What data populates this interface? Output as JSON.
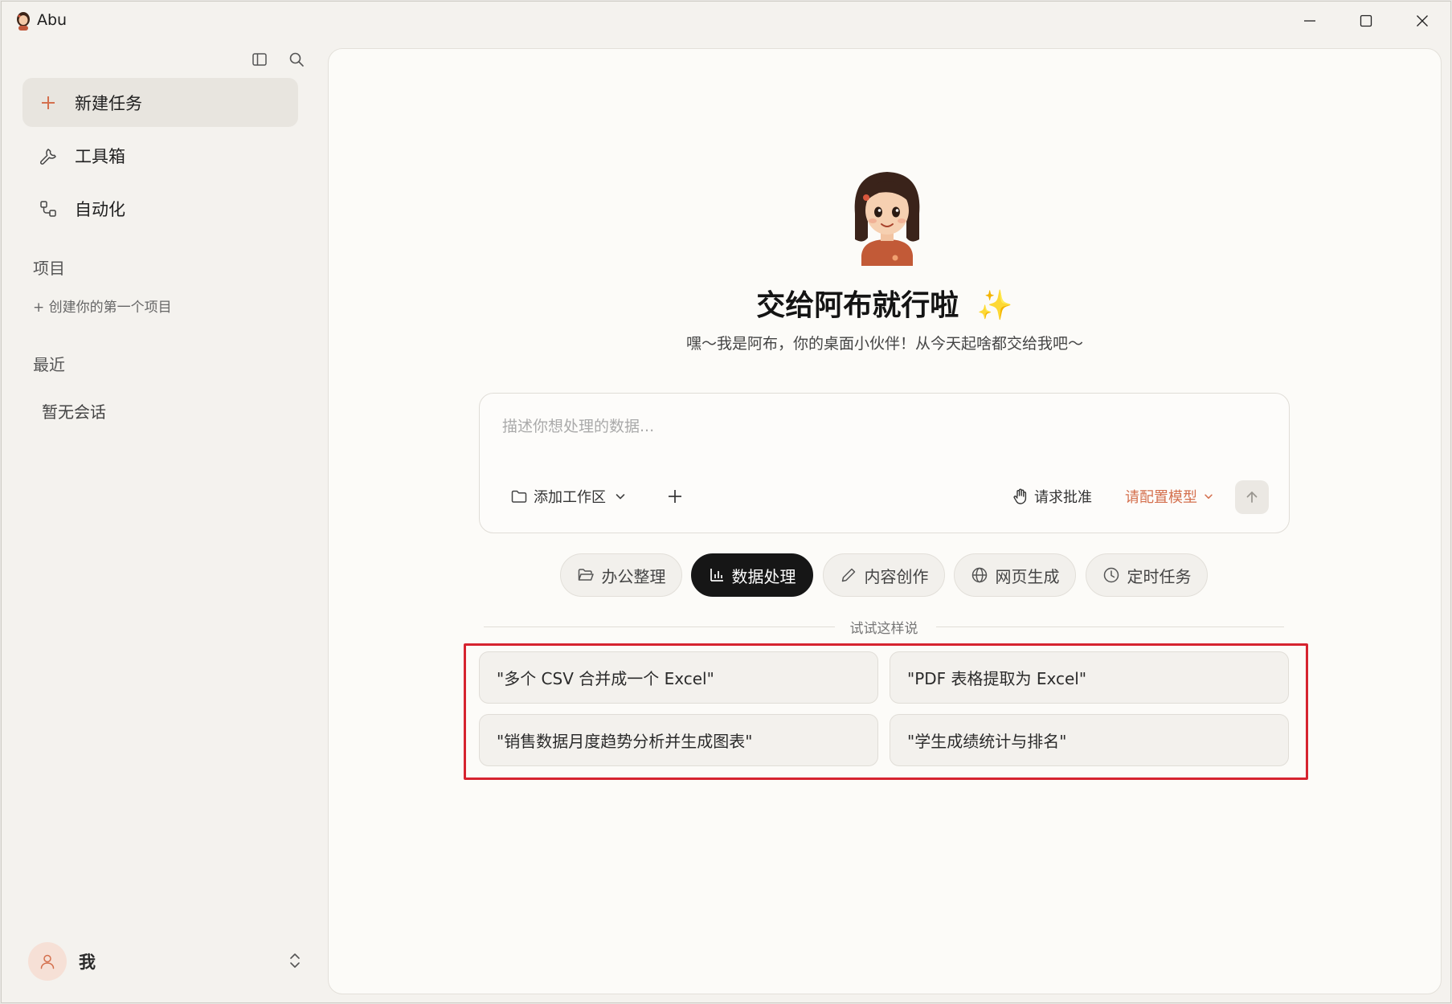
{
  "window": {
    "title": "Abu",
    "controls": [
      "minimize",
      "maximize",
      "close"
    ]
  },
  "sidebar": {
    "toggle_icon": "sidebar-panel-icon",
    "search_icon": "search-icon",
    "nav": [
      {
        "label": "新建任务",
        "icon": "plus-icon",
        "active": true
      },
      {
        "label": "工具箱",
        "icon": "wrench-icon",
        "active": false
      },
      {
        "label": "自动化",
        "icon": "workflow-icon",
        "active": false
      }
    ],
    "projects": {
      "title": "项目",
      "create_label": "+ 创建你的第一个项目"
    },
    "recent": {
      "title": "最近",
      "empty_label": "暂无会话"
    },
    "user": {
      "name": "我"
    }
  },
  "main": {
    "hero_title": "交给阿布就行啦",
    "hero_emoji": "✨",
    "hero_subtitle": "嘿～我是阿布，你的桌面小伙伴！从今天起啥都交给我吧～",
    "input": {
      "placeholder": "描述你想处理的数据...",
      "value": "",
      "workspace_label": "添加工作区",
      "approval_label": "请求批准",
      "model_label": "请配置模型"
    },
    "categories": [
      {
        "label": "办公整理",
        "icon": "folder-open-icon",
        "active": false
      },
      {
        "label": "数据处理",
        "icon": "bar-chart-icon",
        "active": true
      },
      {
        "label": "内容创作",
        "icon": "pencil-icon",
        "active": false
      },
      {
        "label": "网页生成",
        "icon": "globe-icon",
        "active": false
      },
      {
        "label": "定时任务",
        "icon": "clock-icon",
        "active": false
      }
    ],
    "suggestions_title": "试试这样说",
    "suggestions": [
      "\"多个 CSV 合并成一个 Excel\"",
      "\"PDF 表格提取为 Excel\"",
      "\"销售数据月度趋势分析并生成图表\"",
      "\"学生成绩统计与排名\""
    ]
  },
  "colors": {
    "accent": "#d4704e",
    "active_chip": "#161616",
    "highlight": "#d6232f",
    "panel_bg": "#fcfbf8",
    "sidebar_bg": "#f4f2ee"
  }
}
